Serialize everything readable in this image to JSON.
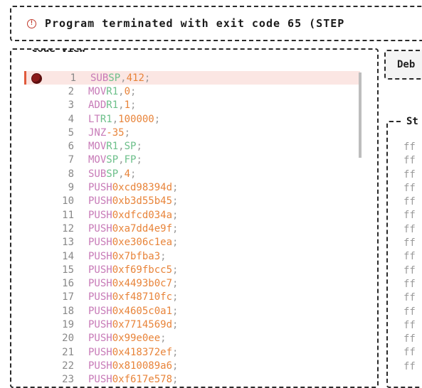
{
  "banner": {
    "message": "Program terminated with exit code 65 (STEP"
  },
  "code_view": {
    "title": "Code View",
    "lines": [
      {
        "n": "1",
        "op": "SUB",
        "args": [
          {
            "t": "reg",
            "v": "SP"
          },
          {
            "t": "num",
            "v": "412"
          }
        ],
        "breakpoint": true,
        "active": true
      },
      {
        "n": "2",
        "op": "MOV",
        "args": [
          {
            "t": "reg",
            "v": "R1"
          },
          {
            "t": "num",
            "v": "0"
          }
        ]
      },
      {
        "n": "3",
        "op": "ADD",
        "args": [
          {
            "t": "reg",
            "v": "R1"
          },
          {
            "t": "num",
            "v": "1"
          }
        ]
      },
      {
        "n": "4",
        "op": "LT",
        "args": [
          {
            "t": "reg",
            "v": "R1"
          },
          {
            "t": "num",
            "v": "100000"
          }
        ]
      },
      {
        "n": "5",
        "op": "JNZ",
        "args": [
          {
            "t": "num",
            "v": "-35"
          }
        ]
      },
      {
        "n": "6",
        "op": "MOV",
        "args": [
          {
            "t": "reg",
            "v": "R1"
          },
          {
            "t": "reg",
            "v": "SP"
          }
        ]
      },
      {
        "n": "7",
        "op": "MOV",
        "args": [
          {
            "t": "reg",
            "v": "SP"
          },
          {
            "t": "reg",
            "v": "FP"
          }
        ]
      },
      {
        "n": "8",
        "op": "SUB",
        "args": [
          {
            "t": "reg",
            "v": "SP"
          },
          {
            "t": "num",
            "v": "4"
          }
        ]
      },
      {
        "n": "9",
        "op": "PUSH",
        "args": [
          {
            "t": "num",
            "v": "0xcd98394d"
          }
        ]
      },
      {
        "n": "10",
        "op": "PUSH",
        "args": [
          {
            "t": "num",
            "v": "0xb3d55b45"
          }
        ]
      },
      {
        "n": "11",
        "op": "PUSH",
        "args": [
          {
            "t": "num",
            "v": "0xdfcd034a"
          }
        ]
      },
      {
        "n": "12",
        "op": "PUSH",
        "args": [
          {
            "t": "num",
            "v": "0xa7dd4e9f"
          }
        ]
      },
      {
        "n": "13",
        "op": "PUSH",
        "args": [
          {
            "t": "num",
            "v": "0xe306c1ea"
          }
        ]
      },
      {
        "n": "14",
        "op": "PUSH",
        "args": [
          {
            "t": "num",
            "v": "0x7bfba3"
          }
        ]
      },
      {
        "n": "15",
        "op": "PUSH",
        "args": [
          {
            "t": "num",
            "v": "0xf69fbcc5"
          }
        ]
      },
      {
        "n": "16",
        "op": "PUSH",
        "args": [
          {
            "t": "num",
            "v": "0x4493b0c7"
          }
        ]
      },
      {
        "n": "17",
        "op": "PUSH",
        "args": [
          {
            "t": "num",
            "v": "0xf48710fc"
          }
        ]
      },
      {
        "n": "18",
        "op": "PUSH",
        "args": [
          {
            "t": "num",
            "v": "0x4605c0a1"
          }
        ]
      },
      {
        "n": "19",
        "op": "PUSH",
        "args": [
          {
            "t": "num",
            "v": "0x7714569d"
          }
        ]
      },
      {
        "n": "20",
        "op": "PUSH",
        "args": [
          {
            "t": "num",
            "v": "0x99e0ee"
          }
        ]
      },
      {
        "n": "21",
        "op": "PUSH",
        "args": [
          {
            "t": "num",
            "v": "0x418372ef"
          }
        ]
      },
      {
        "n": "22",
        "op": "PUSH",
        "args": [
          {
            "t": "num",
            "v": "0x810089a6"
          }
        ]
      },
      {
        "n": "23",
        "op": "PUSH",
        "args": [
          {
            "t": "num",
            "v": "0xf617e578"
          }
        ]
      }
    ]
  },
  "debug_tab": {
    "label": "Deb"
  },
  "stack_panel": {
    "title": "St",
    "rows": [
      "ff",
      "ff",
      "ff",
      "ff",
      "ff",
      "ff",
      "ff",
      "ff",
      "ff",
      "ff",
      "ff",
      "ff",
      "ff",
      "ff",
      "ff",
      "ff",
      "ff"
    ]
  },
  "colors": {
    "opcode": "#c77ab7",
    "register": "#6cbf8a",
    "number": "#e8843a",
    "line_number": "#888888",
    "breakpoint": "#8b1a1a",
    "active_line_bg": "#fbe6e3"
  },
  "icons": {
    "banner": "warning-icon",
    "breakpoint": "breakpoint-dot-icon"
  }
}
